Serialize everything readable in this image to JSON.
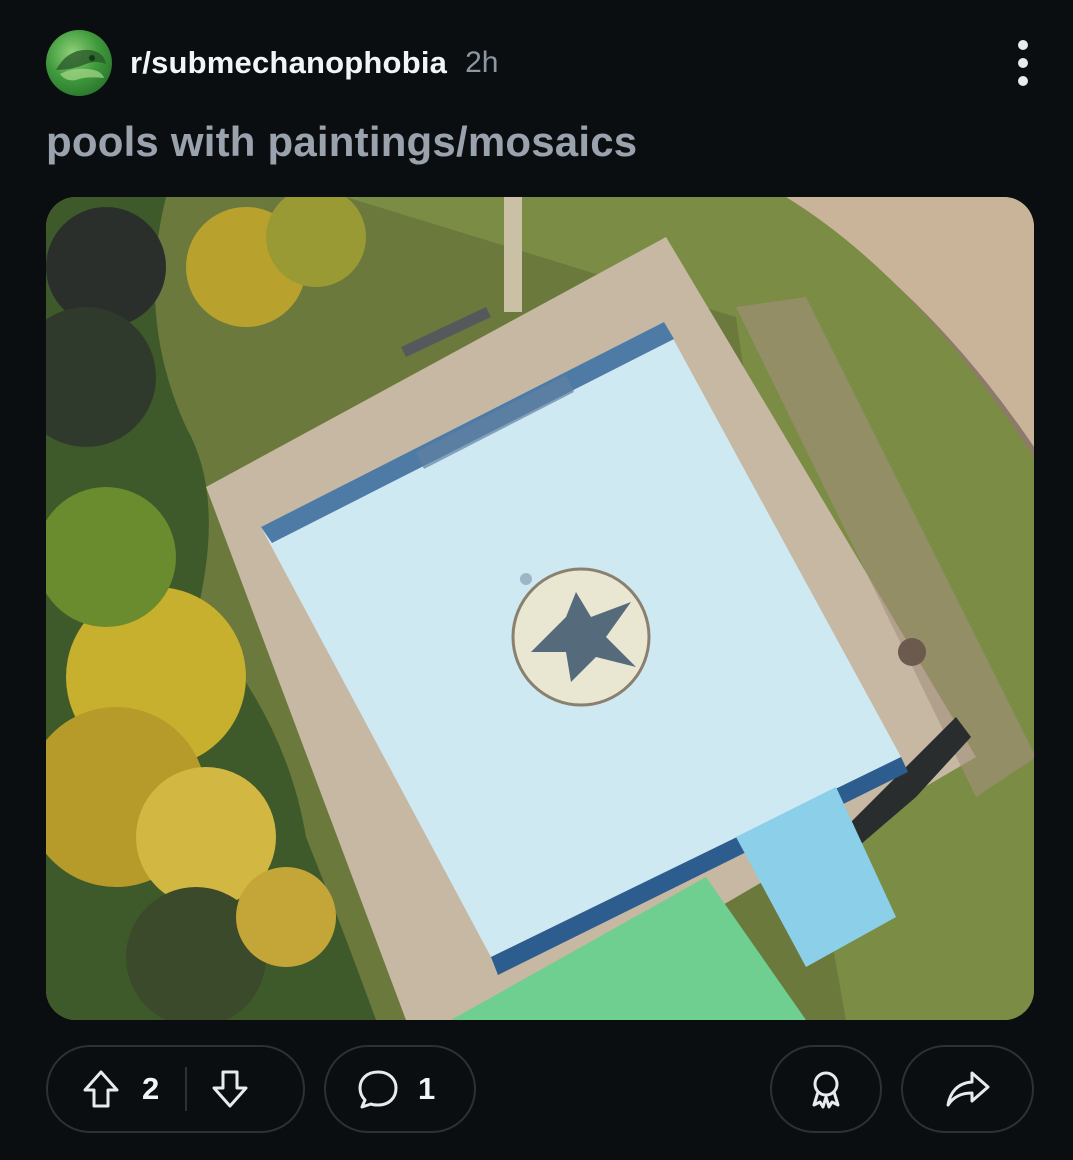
{
  "post": {
    "subreddit": "r/submechanophobia",
    "age": "2h",
    "title": "pools with paintings/mosaics"
  },
  "media": {
    "description_icon": "image",
    "gallery_index": 1
  },
  "actions": {
    "upvotes": "2",
    "comments": "1"
  },
  "icons": {
    "avatar": "subreddit-avatar",
    "more": "more-vertical-icon",
    "upvote": "arrow-up-icon",
    "downvote": "arrow-down-icon",
    "comment": "comment-bubble-icon",
    "award": "award-icon",
    "share": "share-arrow-icon"
  },
  "colors": {
    "background": "#0b0e11",
    "title": "#9aa3ad",
    "border": "#2a3138",
    "age": "#8c97a3"
  }
}
